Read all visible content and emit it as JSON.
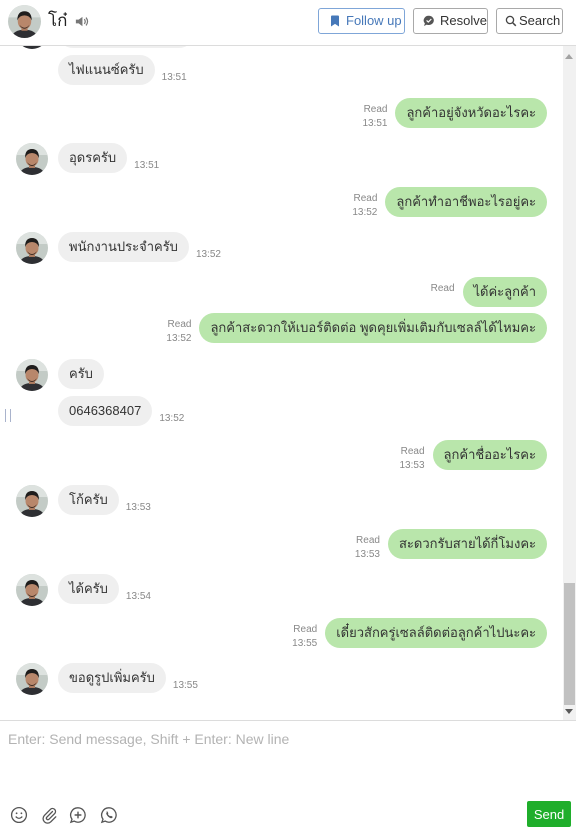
{
  "header": {
    "contact_name": "โก๋",
    "avatar_icon": "contact-avatar",
    "sound_icon": "speaker-icon",
    "follow_up": {
      "label": "Follow up",
      "icon": "bookmark-icon"
    },
    "resolve": {
      "label": "Resolve",
      "icon": "resolve-chat-icon"
    },
    "search": {
      "label": "Search",
      "icon": "search-icon"
    }
  },
  "colors": {
    "incoming_bubble": "#efefef",
    "outgoing_bubble": "#b9e6ab",
    "follow_up_blue": "#4678b9",
    "send_green": "#1fae2b",
    "meta_text": "#888888"
  },
  "messages": [
    {
      "text": "ไฟแนนซ์ครับ",
      "time": "13:51"
    },
    {
      "text": "ลูกค้าอยู่จังหวัดอะไรคะ",
      "status": "Read",
      "time": "13:51"
    },
    {
      "text": "อุดรครับ",
      "time": "13:51"
    },
    {
      "text": "ลูกค้าทำอาชีพอะไรอยู่คะ",
      "status": "Read",
      "time": "13:52"
    },
    {
      "text": "พนักงานประจำครับ",
      "time": "13:52"
    },
    {
      "text": "ได้ค่ะลูกค้า",
      "status": "Read"
    },
    {
      "text": "ลูกค้าสะดวกให้เบอร์ติดต่อ พูดคุยเพิ่มเติมกับเซลล์ได้ไหมคะ",
      "status": "Read",
      "time": "13:52"
    },
    {
      "text": "ครับ"
    },
    {
      "text": "0646368407",
      "time": "13:52"
    },
    {
      "text": "ลูกค้าชื่ออะไรคะ",
      "status": "Read",
      "time": "13:53"
    },
    {
      "text": "โก้ครับ",
      "time": "13:53"
    },
    {
      "text": "สะดวกรับสายได้กี่โมงคะ",
      "status": "Read",
      "time": "13:53"
    },
    {
      "text": "ได้ครับ",
      "time": "13:54"
    },
    {
      "text": "เดี๋ยวสักครู่เซลล์ติดต่อลูกค้าไปนะคะ",
      "status": "Read",
      "time": "13:55"
    },
    {
      "text": "ขอดูรูปเพิ่มครับ",
      "time": "13:55"
    }
  ],
  "composer": {
    "placeholder": "Enter: Send message, Shift + Enter: New line",
    "send_label": "Send",
    "tools": [
      "emoji-icon",
      "attachment-icon",
      "add-icon",
      "call-icon"
    ]
  }
}
